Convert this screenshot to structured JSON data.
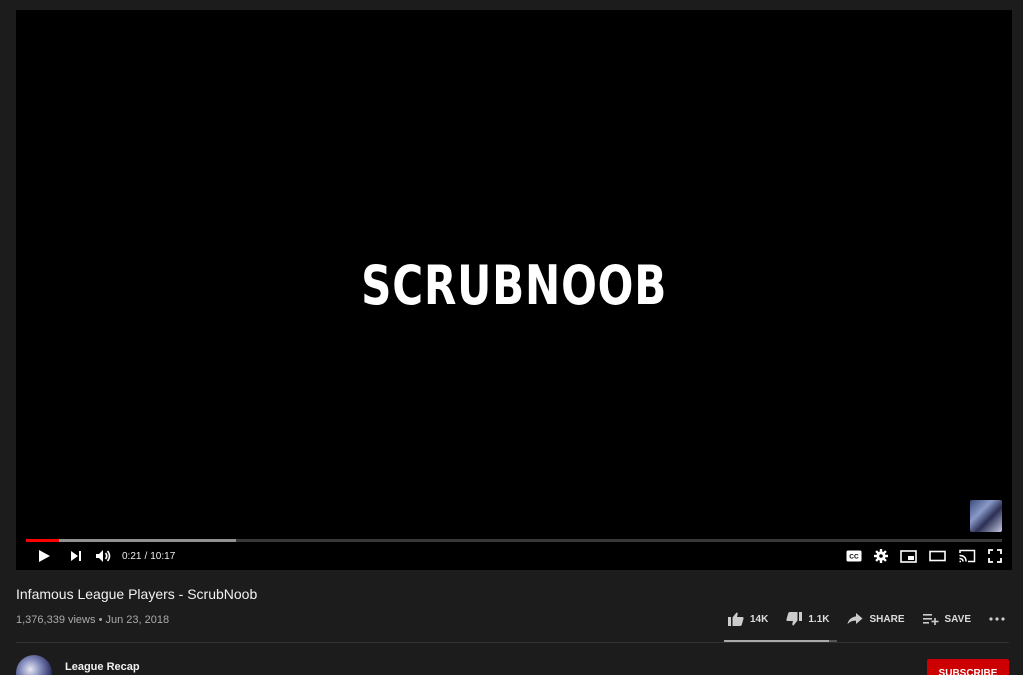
{
  "player": {
    "title_card_text": "SCRUBNOOB",
    "progress": {
      "played_fraction": 0.034,
      "buffered_fraction": 0.215
    },
    "time": {
      "current": "0:21",
      "separator": "/",
      "duration": "10:17"
    },
    "controls_left": [
      "play-icon",
      "next-icon",
      "volume-icon"
    ],
    "controls_right": [
      "captions-icon",
      "settings-icon",
      "miniplayer-icon",
      "theater-icon",
      "cast-icon",
      "fullscreen-icon"
    ]
  },
  "video": {
    "title": "Infamous League Players - ScrubNoob",
    "views": "1,376,339 views",
    "dot": "•",
    "date": "Jun 23, 2018"
  },
  "actions": {
    "likes": "14K",
    "dislikes": "1.1K",
    "share_label": "SHARE",
    "save_label": "SAVE",
    "like_ratio": 0.927
  },
  "channel": {
    "name": "League Recap",
    "subscribe_label": "SUBSCRIBE"
  },
  "colors": {
    "background": "#1c1c1c",
    "player_background": "#000000",
    "progress_played": "#ff0000",
    "subscribe": "#cc0000"
  }
}
